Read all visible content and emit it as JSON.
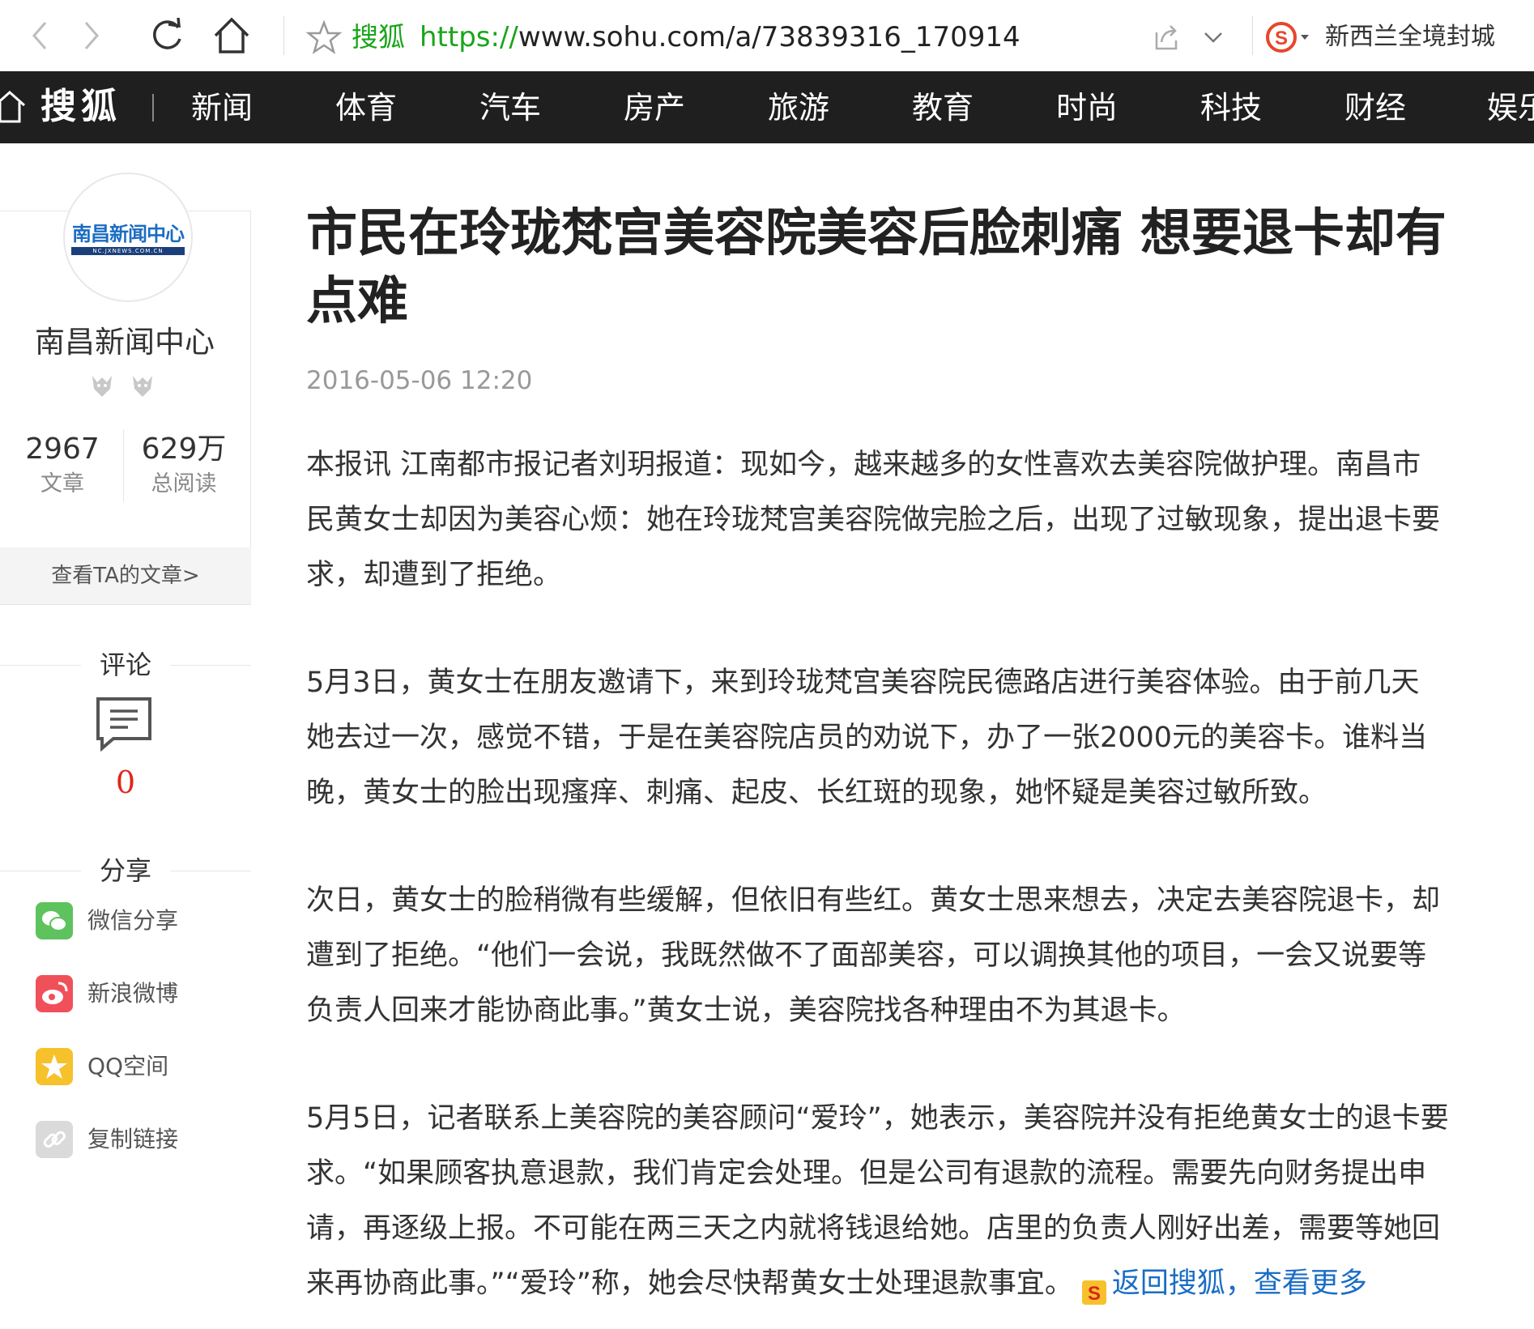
{
  "browser": {
    "site_name": "搜狐",
    "url_scheme": "https://",
    "url_rest": "www.sohu.com/a/73839316_170914",
    "hot_search": "新西兰全境封城"
  },
  "nav": {
    "logo": "搜狐",
    "items": [
      "新闻",
      "体育",
      "汽车",
      "房产",
      "旅游",
      "教育",
      "时尚",
      "科技",
      "财经",
      "娱乐"
    ]
  },
  "author": {
    "avatar_text": "南昌新闻中心",
    "avatar_subtext": "NC.JXNEWS.COM.CN",
    "name": "南昌新闻中心",
    "articles_count": "2967",
    "articles_label": "文章",
    "reads_count": "629万",
    "reads_label": "总阅读",
    "view_articles": "查看TA的文章>"
  },
  "comments": {
    "title": "评论",
    "count": "0"
  },
  "share": {
    "title": "分享",
    "items": [
      {
        "label": "微信分享",
        "icon": "wechat-icon",
        "color": "#5ec25e"
      },
      {
        "label": "新浪微博",
        "icon": "weibo-icon",
        "color": "#f0505a"
      },
      {
        "label": "QQ空间",
        "icon": "qzone-icon",
        "color": "#f7c12c"
      },
      {
        "label": "复制链接",
        "icon": "link-icon",
        "color": "#d8d8d8"
      }
    ]
  },
  "article": {
    "title_line1": "市民在玲珑梵宫美容院美容后脸刺痛 想要退卡却有",
    "title_line2": "点难",
    "date": "2016-05-06 12:20",
    "paragraphs": [
      [
        "本报讯 江南都市报记者刘玥报道：现如今，越来越多的女性喜欢去美容院做护理。南昌市",
        "民黄女士却因为美容心烦：她在玲珑梵宫美容院做完脸之后，出现了过敏现象，提出退卡要",
        "求，却遭到了拒绝。"
      ],
      [
        "5月3日，黄女士在朋友邀请下，来到玲珑梵宫美容院民德路店进行美容体验。由于前几天",
        "她去过一次，感觉不错，于是在美容院店员的劝说下，办了一张2000元的美容卡。谁料当",
        "晚，黄女士的脸出现瘙痒、刺痛、起皮、长红斑的现象，她怀疑是美容过敏所致。"
      ],
      [
        "次日，黄女士的脸稍微有些缓解，但依旧有些红。黄女士思来想去，决定去美容院退卡，却",
        "遭到了拒绝。“他们一会说，我既然做不了面部美容，可以调换其他的项目，一会又说要等",
        "负责人回来才能协商此事。”黄女士说，美容院找各种理由不为其退卡。"
      ],
      [
        "5月5日，记者联系上美容院的美容顾问“爱玲”，她表示，美容院并没有拒绝黄女士的退卡要",
        "求。“如果顾客执意退款，我们肯定会处理。但是公司有退款的流程。需要先向财务提出申",
        "请，再逐级上报。不可能在两三天之内就将钱退给她。店里的负责人刚好出差，需要等她回",
        "来再协商此事。”“爱玲”称，她会尽快帮黄女士处理退款事宜。"
      ]
    ],
    "back_link": "返回搜狐，查看更多"
  }
}
